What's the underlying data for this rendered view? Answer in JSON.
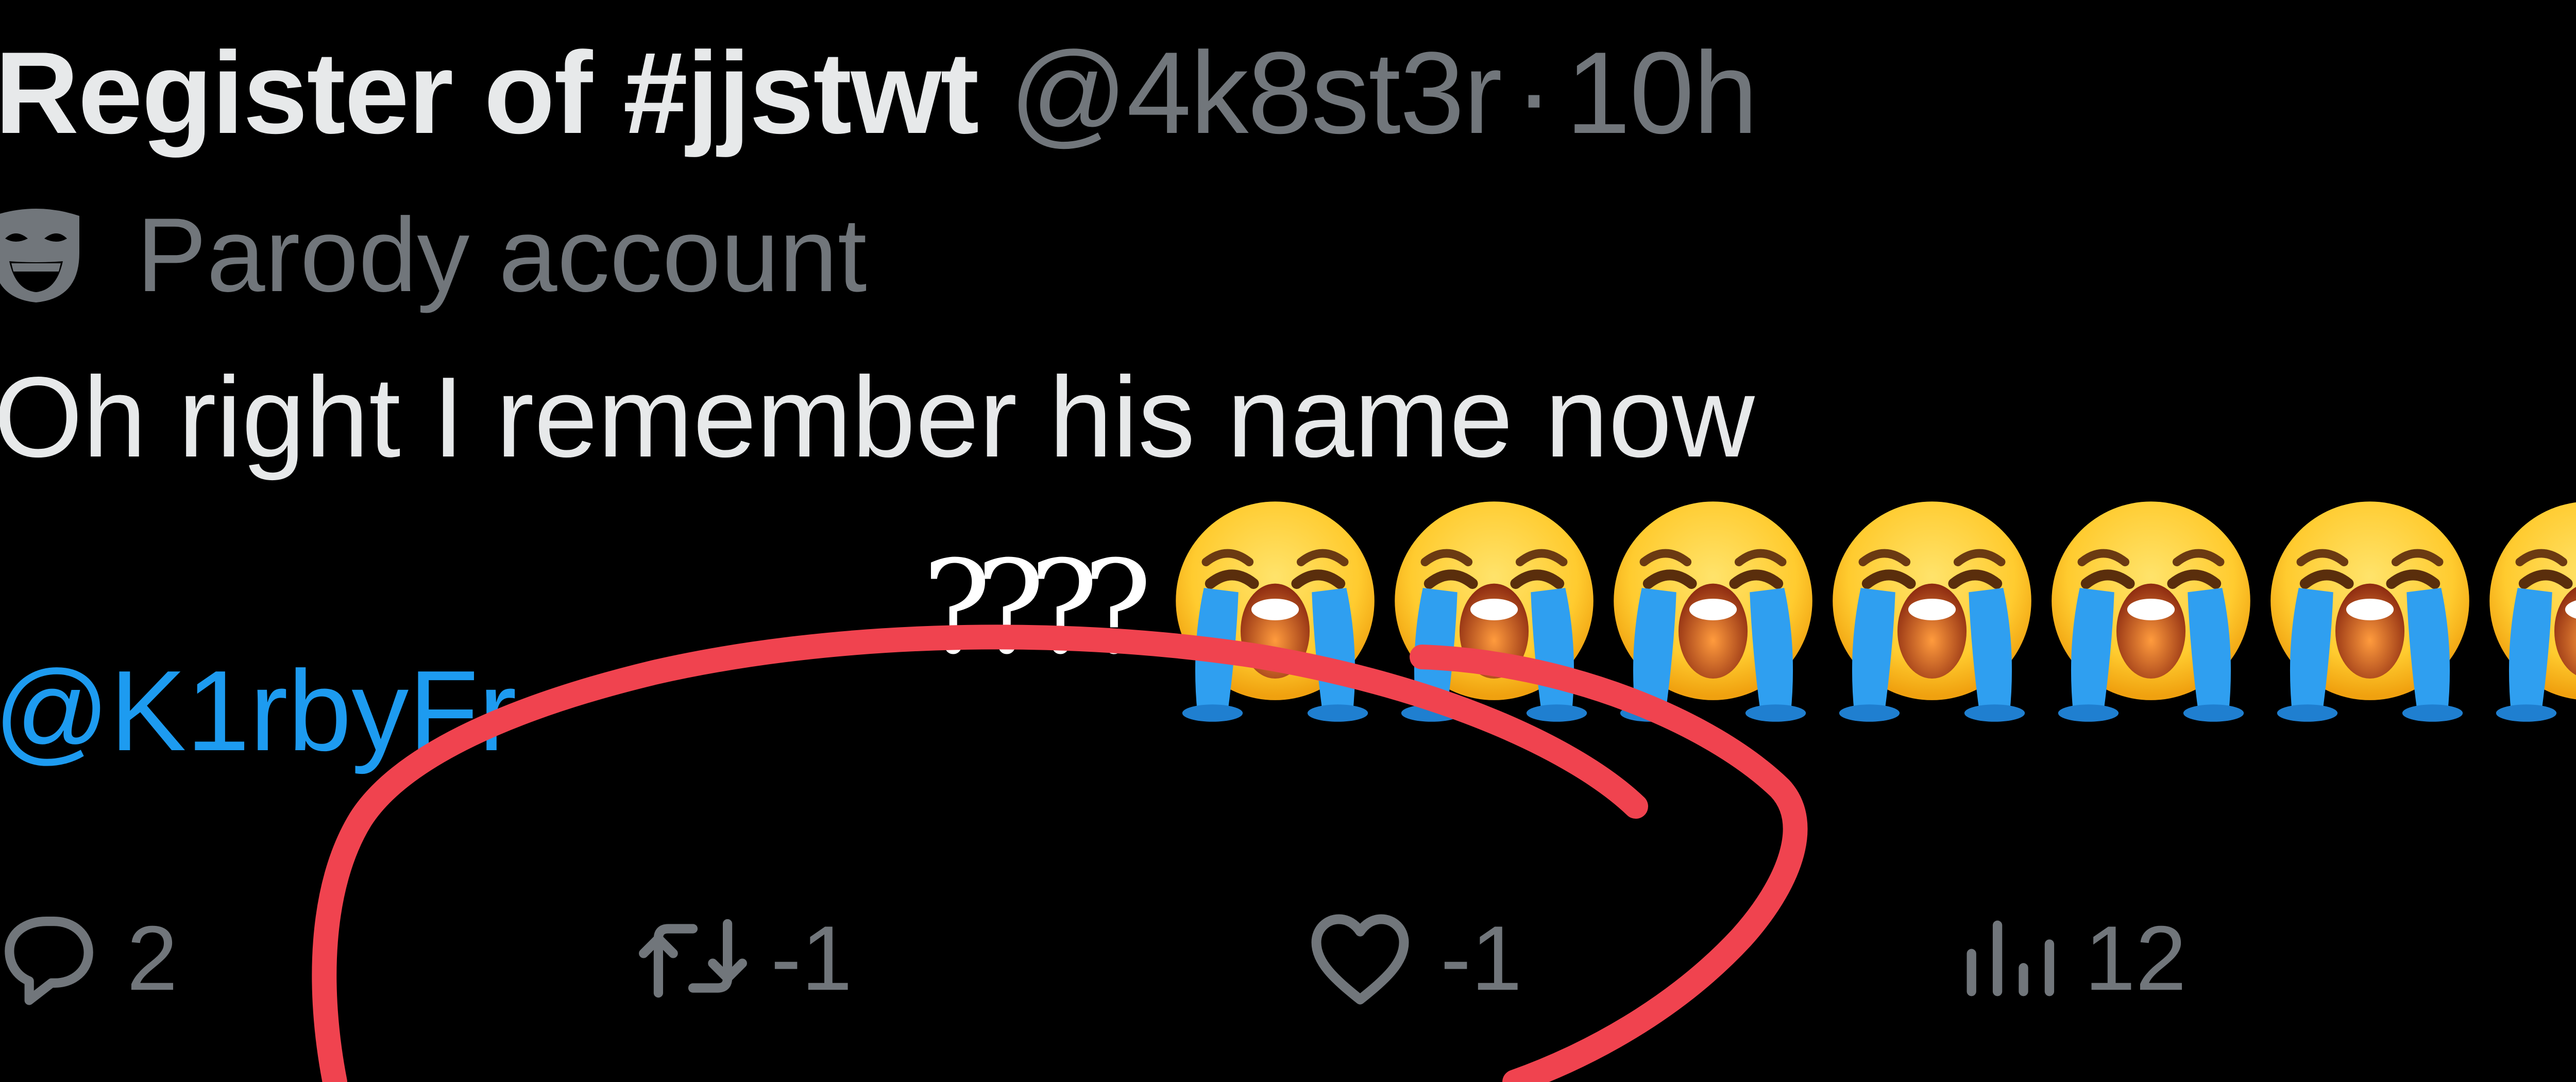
{
  "tweet": {
    "display_name": "Register of #jjstwt",
    "handle": "@4k8st3r",
    "separator": "·",
    "time": "10h",
    "parody_label": "Parody account",
    "text": "Oh right I remember his name now",
    "mention": "@K1rbyFr"
  },
  "actions": {
    "reply_count": "2",
    "retweet_count": "-1",
    "like_count": "-1",
    "views_count": "12"
  },
  "overlay": {
    "caption": "????",
    "emoji_name": "loudly-crying-face-icon",
    "emoji_count": 7,
    "circle_color": "#f0434f"
  },
  "colors": {
    "background": "#000000",
    "primary_text": "#e7e9ea",
    "secondary_text": "#71767b",
    "mention_blue": "#1d9bf0"
  }
}
